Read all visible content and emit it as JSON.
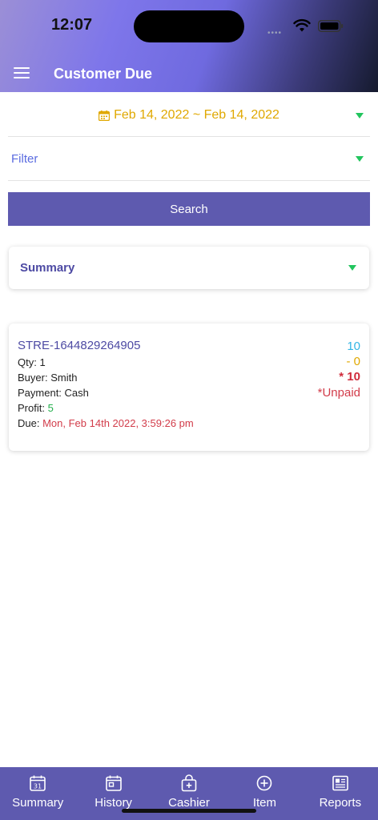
{
  "status_bar": {
    "time": "12:07",
    "signal": "••••"
  },
  "header": {
    "title": "Customer Due",
    "menu_icon": "hamburger-menu-icon"
  },
  "date_filter": {
    "value": "Feb 14, 2022 ~ Feb 14, 2022",
    "icon": "calendar-icon"
  },
  "filter": {
    "label": "Filter"
  },
  "search_button": {
    "label": "Search"
  },
  "summary": {
    "label": "Summary"
  },
  "due_item": {
    "reference": "STRE-1644829264905",
    "qty_label": "Qty:",
    "qty": "1",
    "buyer_label": "Buyer:",
    "buyer": "Smith",
    "payment_label": "Payment:",
    "payment": "Cash",
    "profit_label": "Profit:",
    "profit": "5",
    "due_label": "Due:",
    "due": "Mon, Feb 14th 2022, 3:59:26 pm",
    "amount": "10",
    "discount": "- 0",
    "total": "* 10",
    "status": "*Unpaid"
  },
  "colors": {
    "accent": "#5e5aaf",
    "date": "#e0a800",
    "caret": "#22c55e",
    "unpaid": "#d23c4a",
    "profit": "#22b04b"
  },
  "tabs": [
    {
      "label": "Summary",
      "icon": "calendar-31-icon"
    },
    {
      "label": "History",
      "icon": "calendar-icon"
    },
    {
      "label": "Cashier",
      "icon": "bag-plus-icon"
    },
    {
      "label": "Item",
      "icon": "plus-circle-icon"
    },
    {
      "label": "Reports",
      "icon": "newspaper-icon"
    }
  ]
}
